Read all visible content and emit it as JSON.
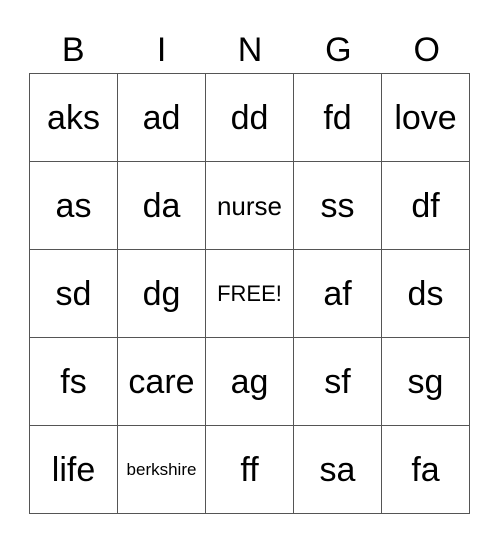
{
  "header": [
    "B",
    "I",
    "N",
    "G",
    "O"
  ],
  "rows": [
    [
      "aks",
      "ad",
      "dd",
      "fd",
      "love"
    ],
    [
      "as",
      "da",
      "nurse",
      "ss",
      "df"
    ],
    [
      "sd",
      "dg",
      "FREE!",
      "af",
      "ds"
    ],
    [
      "fs",
      "care",
      "ag",
      "sf",
      "sg"
    ],
    [
      "life",
      "berkshire",
      "ff",
      "sa",
      "fa"
    ]
  ]
}
